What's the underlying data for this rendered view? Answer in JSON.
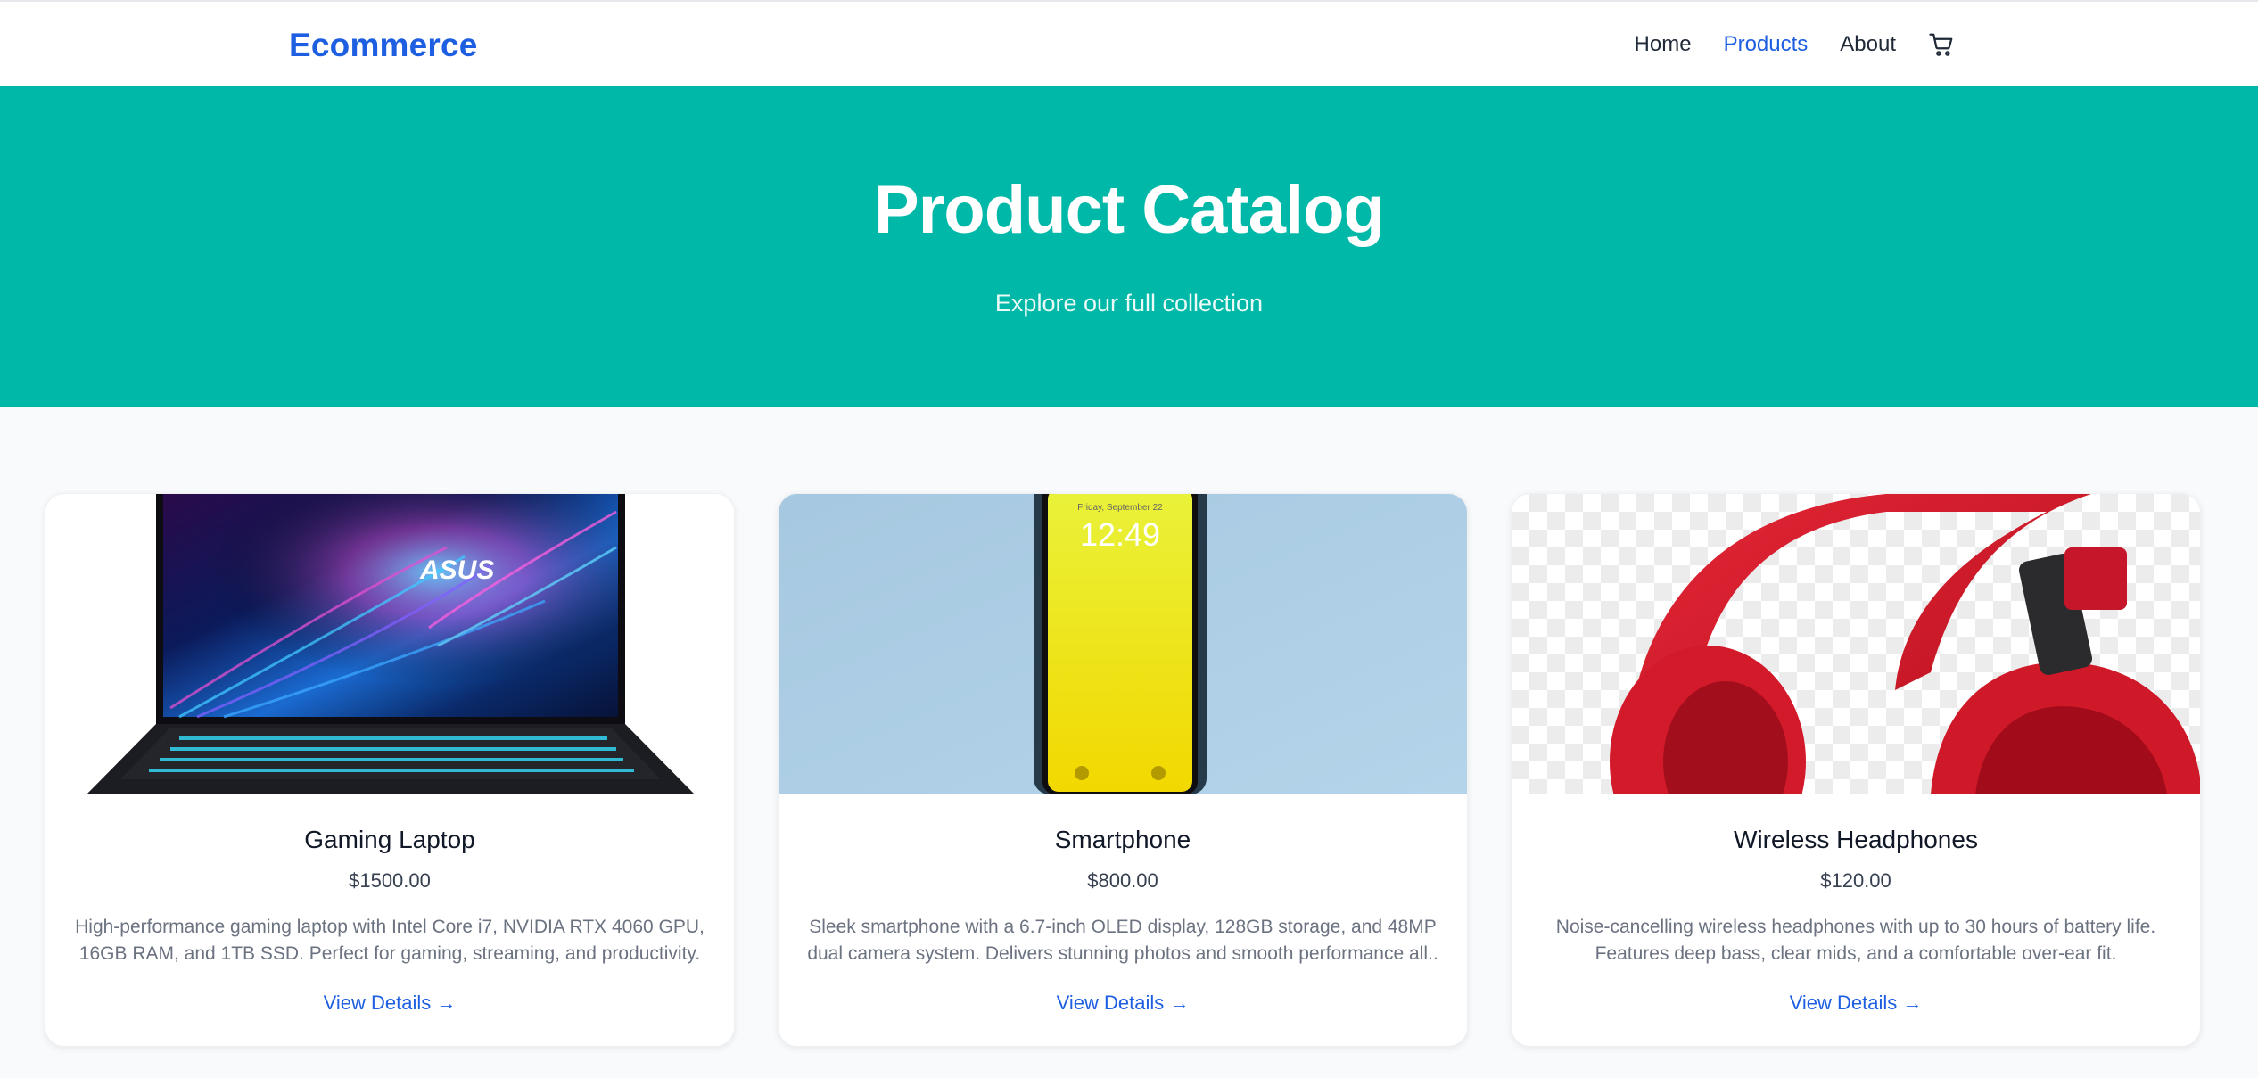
{
  "header": {
    "brand": "Ecommerce",
    "nav": {
      "home": "Home",
      "products": "Products",
      "about": "About"
    },
    "cart_icon": "cart-icon"
  },
  "hero": {
    "title": "Product Catalog",
    "subtitle": "Explore our full collection"
  },
  "products": [
    {
      "name": "Gaming Laptop",
      "price": "$1500.00",
      "description": "High-performance gaming laptop with Intel Core i7, NVIDIA RTX 4060 GPU, 16GB RAM, and 1TB SSD. Perfect for gaming, streaming, and productivity.",
      "link": "View Details →",
      "image_brand": "ASUS"
    },
    {
      "name": "Smartphone",
      "price": "$800.00",
      "description": "Sleek smartphone with a 6.7-inch OLED display, 128GB storage, and 48MP dual camera system. Delivers stunning photos and smooth performance all..",
      "link": "View Details →",
      "image_time": "12:49"
    },
    {
      "name": "Wireless Headphones",
      "price": "$120.00",
      "description": "Noise-cancelling wireless headphones with up to 30 hours of battery life. Features deep bass, clear mids, and a comfortable over-ear fit.",
      "link": "View Details →"
    }
  ],
  "colors": {
    "brand": "#1d5fe0",
    "hero_bg": "#00b8a8",
    "page_bg": "#f8fafc"
  }
}
